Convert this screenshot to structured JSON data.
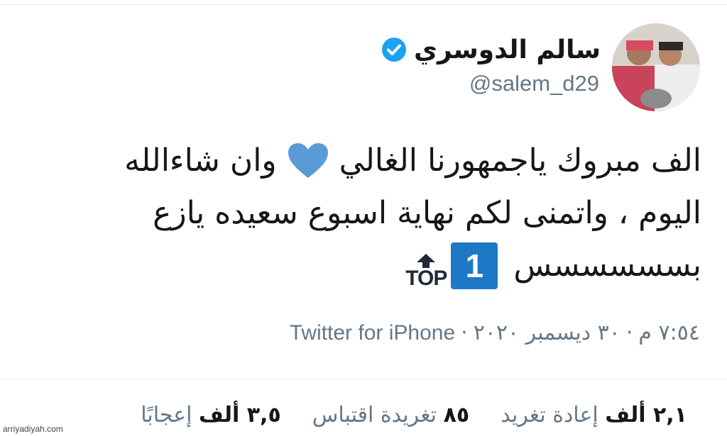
{
  "author": {
    "name": "سالم الدوسري",
    "handle": "@salem_d29"
  },
  "tweet": {
    "line1": "الف مبروك ياجمهورنا الغالي",
    "line1_end": "وان شاءالله",
    "line2": "اليوم ، واتمنى لكم نهاية اسبوع سعيده يازع",
    "line3": "بسسسسسس",
    "badge_number": "1",
    "badge_label": "TOP"
  },
  "meta": {
    "time": "٧:٥٤ م",
    "date": "٣٠ ديسمبر ٢٠٢٠",
    "separator": "·",
    "source": "Twitter for iPhone"
  },
  "stats": [
    {
      "value": "٢,١ ألف",
      "label": "إعادة تغريد"
    },
    {
      "value": "٨٥",
      "label": "تغريدة اقتباس"
    },
    {
      "value": "٣,٥ ألف",
      "label": "إعجابًا"
    }
  ],
  "watermark": "arriyadiyah.com",
  "colors": {
    "verified": "#1da1f2",
    "heart": "#5b9bd5",
    "badge": "#1d78c6"
  }
}
